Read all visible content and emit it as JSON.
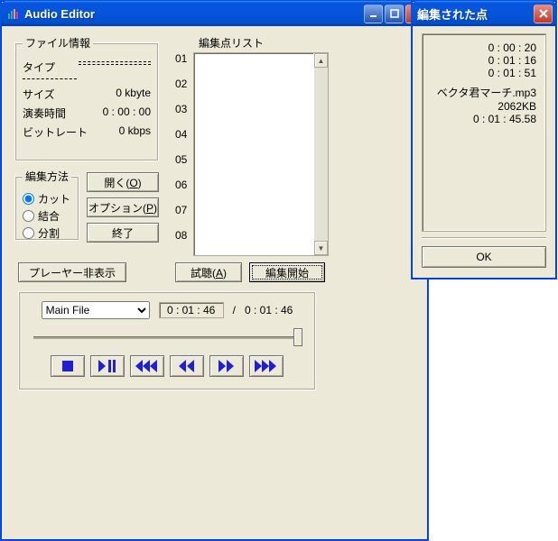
{
  "main": {
    "title": "Audio Editor",
    "file_info": {
      "legend": "ファイル情報",
      "type_label": "タイプ",
      "type_value": "",
      "size_label": "サイズ",
      "size_value": "0 kbyte",
      "duration_label": "演奏時間",
      "duration_value": "0 : 00 : 00",
      "bitrate_label": "ビットレート",
      "bitrate_value": "0 kbps"
    },
    "edit_method": {
      "legend": "編集方法",
      "cut": "カット",
      "join": "結合",
      "split": "分割",
      "selected": "cut"
    },
    "buttons": {
      "open": "開く(O)",
      "option": "オプション(P)",
      "exit": "終了",
      "hide_player": "プレーヤー非表示",
      "listen": "試聴(A)",
      "start_edit": "編集開始"
    },
    "editpoints": {
      "legend": "編集点リスト",
      "rows": [
        "01",
        "02",
        "03",
        "04",
        "05",
        "06",
        "07",
        "08"
      ]
    },
    "player": {
      "file_select": "Main File",
      "position": "0 : 01 : 46",
      "separator": "/",
      "duration": "0 : 01 : 46"
    }
  },
  "dialog": {
    "title": "編集された点",
    "times": [
      "0 : 00 : 20",
      "0 : 01 : 16",
      "0 : 01 : 51"
    ],
    "filename": "ベクタ君マーチ.mp3",
    "filesize": "2062KB",
    "duration": "0 : 01 : 45.58",
    "ok": "OK"
  }
}
